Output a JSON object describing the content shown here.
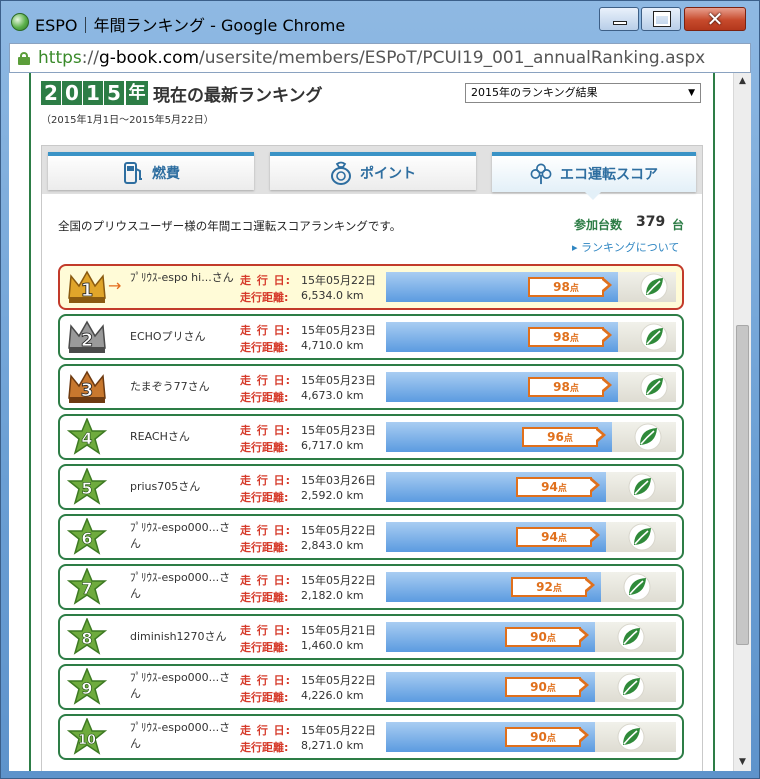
{
  "window": {
    "title": "ESPO｜年間ランキング - Google Chrome",
    "minimize_icon": "minimize-icon",
    "maximize_icon": "maximize-icon",
    "close_icon": "close-icon"
  },
  "address": {
    "scheme": "https",
    "sep": "://",
    "host": "g-book.com",
    "path": "/usersite/members/ESPoT/PCUI19_001_annualRanking.aspx"
  },
  "heading": {
    "year_digits": [
      "2",
      "0",
      "1",
      "5"
    ],
    "year_kanji": "年",
    "title": "現在の最新ランキング",
    "period": "（2015年1月1日～2015年5月22日）",
    "select_value": "2015年のランキング結果"
  },
  "tabs": [
    {
      "label": "燃費",
      "icon": "fuel-pump-icon",
      "selected": false
    },
    {
      "label": "ポイント",
      "icon": "point-bag-icon",
      "selected": false
    },
    {
      "label": "エコ運転スコア",
      "icon": "eco-flower-icon",
      "selected": true
    }
  ],
  "summary": {
    "intro": "全国のプリウスユーザー様の年間エコ運転スコアランキングです。",
    "count_label": "参加台数",
    "count_value": "379",
    "count_unit": "台",
    "about_link": "ランキングについて"
  },
  "labels": {
    "date_label": "走 行 日:",
    "distance_label": "走行距離:",
    "point_unit": "点"
  },
  "colors": {
    "green": "#2d7d46",
    "red_label": "#d63a2a",
    "score_orange": "#e0701c",
    "bar_blue": "#5b9be0",
    "tab_blue": "#3a93c6"
  },
  "rankings": [
    {
      "rank": "1",
      "name": "ﾌﾟﾘｳｽ-espo hi...さん",
      "date": "15年05月22日",
      "distance": "6,534.0 km",
      "score": "98",
      "score_pct": 0.8
    },
    {
      "rank": "2",
      "name": "ECHOプリさん",
      "date": "15年05月23日",
      "distance": "4,710.0 km",
      "score": "98",
      "score_pct": 0.8
    },
    {
      "rank": "3",
      "name": "たまぞう77さん",
      "date": "15年05月23日",
      "distance": "4,673.0 km",
      "score": "98",
      "score_pct": 0.8
    },
    {
      "rank": "4",
      "name": "REACHさん",
      "date": "15年05月23日",
      "distance": "6,717.0 km",
      "score": "96",
      "score_pct": 0.78
    },
    {
      "rank": "5",
      "name": "prius705さん",
      "date": "15年03月26日",
      "distance": "2,592.0 km",
      "score": "94",
      "score_pct": 0.76
    },
    {
      "rank": "6",
      "name": "ﾌﾟﾘｳｽ-espo000...さん",
      "date": "15年05月22日",
      "distance": "2,843.0 km",
      "score": "94",
      "score_pct": 0.76
    },
    {
      "rank": "7",
      "name": "ﾌﾟﾘｳｽ-espo000...さん",
      "date": "15年05月22日",
      "distance": "2,182.0 km",
      "score": "92",
      "score_pct": 0.74
    },
    {
      "rank": "8",
      "name": "diminish1270さん",
      "date": "15年05月21日",
      "distance": "1,460.0 km",
      "score": "90",
      "score_pct": 0.72
    },
    {
      "rank": "9",
      "name": "ﾌﾟﾘｳｽ-espo000...さん",
      "date": "15年05月22日",
      "distance": "4,226.0 km",
      "score": "90",
      "score_pct": 0.72
    },
    {
      "rank": "10",
      "name": "ﾌﾟﾘｳｽ-espo000...さん",
      "date": "15年05月22日",
      "distance": "8,271.0 km",
      "score": "90",
      "score_pct": 0.72
    }
  ]
}
